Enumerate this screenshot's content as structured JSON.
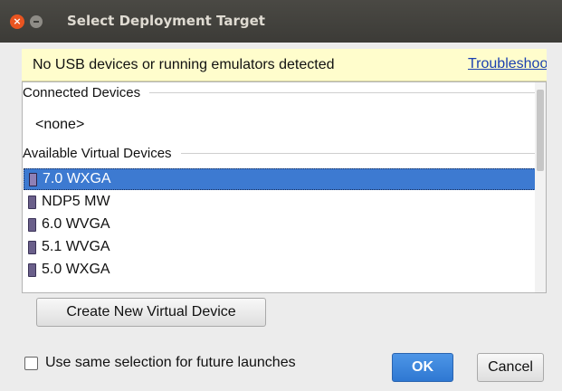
{
  "window": {
    "title": "Select Deployment Target",
    "close_glyph": "×"
  },
  "banner": {
    "message": "No USB devices or running emulators detected",
    "link": "Troubleshoot"
  },
  "connected": {
    "header": "Connected Devices",
    "empty": "<none>"
  },
  "available": {
    "header": "Available Virtual Devices",
    "devices": [
      {
        "label": "7.0 WXGA",
        "icon": "phone-icon",
        "selected": true
      },
      {
        "label": "NDP5 MW",
        "icon": "phone-icon",
        "selected": false
      },
      {
        "label": "6.0 WVGA",
        "icon": "phone-icon",
        "selected": false
      },
      {
        "label": "5.1 WVGA",
        "icon": "phone-icon",
        "selected": false
      },
      {
        "label": "5.0 WXGA",
        "icon": "phone-icon",
        "selected": false
      }
    ]
  },
  "actions": {
    "create_label": "Create New Virtual Device",
    "checkbox_label": "Use same selection for future launches",
    "checkbox_checked": false,
    "ok_label": "OK",
    "cancel_label": "Cancel"
  },
  "colors": {
    "selection": "#3d7ad1",
    "banner_bg": "#fffdcc",
    "titlebar": "#3c3b37",
    "close_button": "#e95420"
  }
}
